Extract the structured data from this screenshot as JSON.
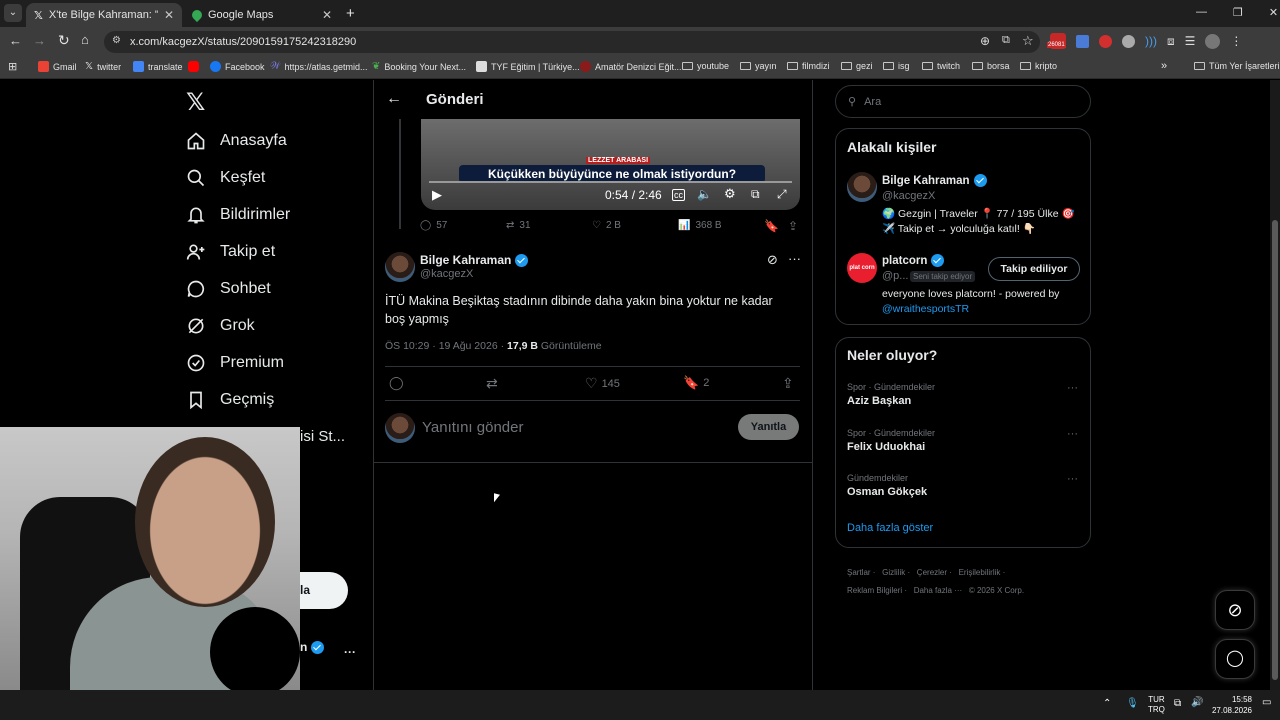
{
  "browser": {
    "tabs": [
      {
        "label": "X'te Bilge Kahraman: \"@platco"
      },
      {
        "label": "Google Maps"
      }
    ],
    "url": "x.com/kacgezX/status/2090159175242318290",
    "ext_badge": "26081",
    "bookmarks": [
      "Gmail",
      "twitter",
      "translate",
      "",
      "Facebook",
      "https://atlas.getmid...",
      "Booking Your Next...",
      "TYF Eğitim | Türkiye...",
      "Amatör Denizci Eğit...",
      "youtube",
      "yayın",
      "filmdizi",
      "gezi",
      "isg",
      "twitch",
      "borsa",
      "kripto"
    ],
    "all_bookmarks": "Tüm Yer İşaretleri"
  },
  "nav": {
    "items": [
      "Anasayfa",
      "Keşfet",
      "Bildirimler",
      "Takip et",
      "Sohbet",
      "Grok",
      "Premium",
      "Geçmiş"
    ],
    "partial_label": "isi St...",
    "post_button_fragment": "la",
    "profile_fragment": "n",
    "more": "···"
  },
  "main": {
    "header_title": "Gönderi",
    "video": {
      "time": "0:54 / 2:46",
      "caption": "Küçükken büyüyünce ne olmak istiyordun?",
      "logo": "LEZZET ARABASI"
    },
    "prev_stats": {
      "replies": "57",
      "reposts": "31",
      "likes": "2 B",
      "views": "368 B"
    },
    "tweet": {
      "name": "Bilge Kahraman",
      "handle": "@kacgezX",
      "text": "İTÜ Makina Beşiktaş stadının dibinde daha yakın bina yoktur ne kadar boş yapmış",
      "meta_time": "ÖS 10:29 · 19 Ağu 2026 · ",
      "meta_views": "17,9 B",
      "meta_views_label": " Görüntüleme",
      "likes": "145",
      "bookmarks": "2"
    },
    "reply": {
      "placeholder": "Yanıtını gönder",
      "button": "Yanıtla"
    }
  },
  "sidebar": {
    "search_placeholder": "Ara",
    "relevant_title": "Alakalı kişiler",
    "people": [
      {
        "name": "Bilge Kahraman",
        "handle": "@kacgezX",
        "bio": "🌍 Gezgin | Traveler 📍 77 / 195 Ülke 🎯 ✈️ Takip et → yolculuğa katıl! 👇🏻"
      },
      {
        "name": "platcorn",
        "handle": "@p...",
        "follows_you": "Seni takip ediyor",
        "button": "Takip ediliyor",
        "bio": "everyone loves platcorn! - powered by ",
        "bio_link": "@wraithesportsTR",
        "avatar_text": "plat corn"
      }
    ],
    "trends_title": "Neler oluyor?",
    "trends": [
      {
        "category": "Spor · Gündemdekiler",
        "name": "Aziz Başkan"
      },
      {
        "category": "Spor · Gündemdekiler",
        "name": "Felix Uduokhai"
      },
      {
        "category": "Gündemdekiler",
        "name": "Osman Gökçek"
      }
    ],
    "show_more": "Daha fazla göster",
    "footer": [
      "Şartlar",
      "Gizlilik",
      "Çerezler",
      "Erişilebilirlik",
      "Reklam Bilgileri",
      "Daha fazla ···",
      "© 2026 X Corp."
    ]
  },
  "taskbar": {
    "lang1": "TUR",
    "lang2": "TRQ",
    "time": "15:58",
    "date": "27.08.2026"
  }
}
